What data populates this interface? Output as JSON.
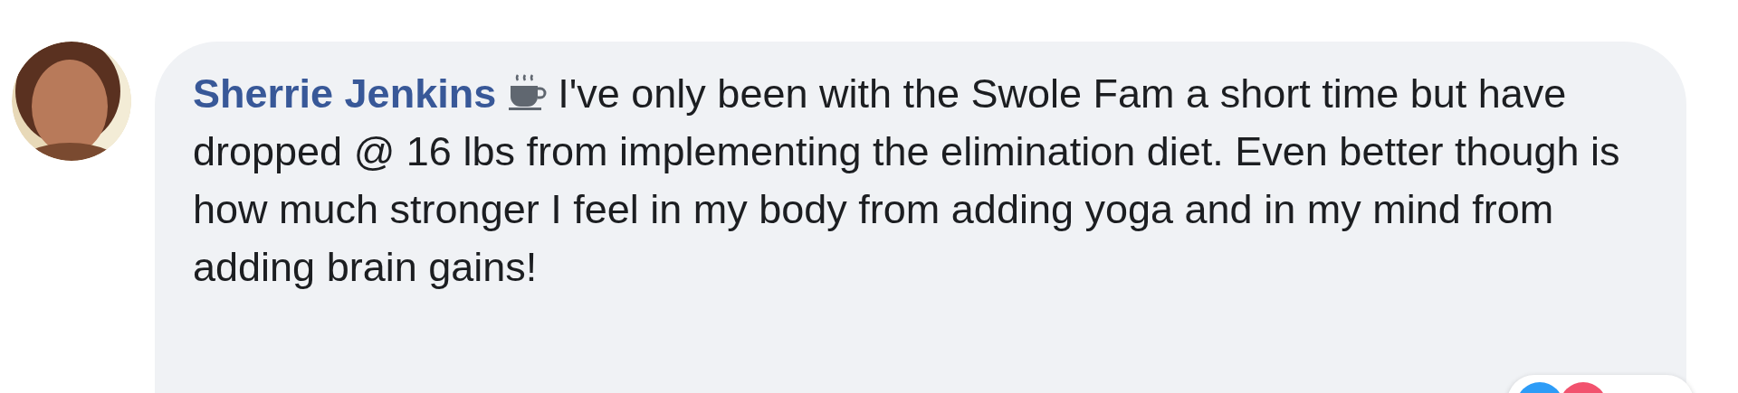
{
  "comment": {
    "author": "Sherrie Jenkins",
    "text": "I've only been with the Swole Fam a short time but have dropped @ 16 lbs from implementing the elimination diet. Even better though is how much stronger I feel in my body from adding yoga and in my mind from adding brain gains!"
  }
}
